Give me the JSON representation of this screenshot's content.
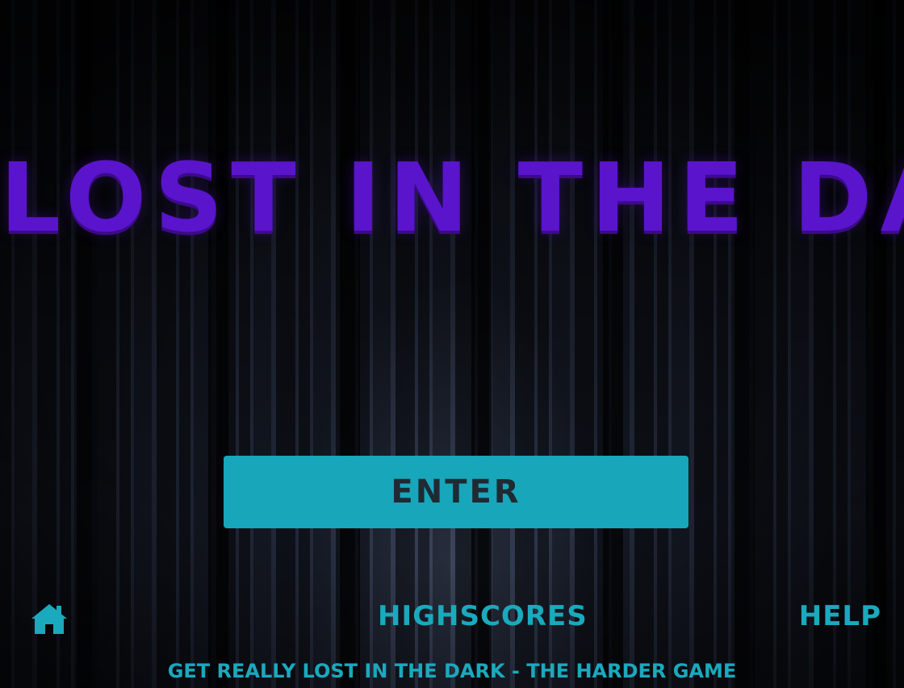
{
  "game": {
    "title": "Lost in the Dark"
  },
  "menu": {
    "enter_label": "Enter"
  },
  "nav": {
    "home_icon": "home-icon",
    "highscores_label": "Highscores",
    "help_label": "Help"
  },
  "footer": {
    "harder_game_label": "Get really lost in the dark - the harder game"
  },
  "colors": {
    "title": "#5a14cc",
    "accent": "#17a6ba",
    "button_text": "#1f2a33"
  }
}
